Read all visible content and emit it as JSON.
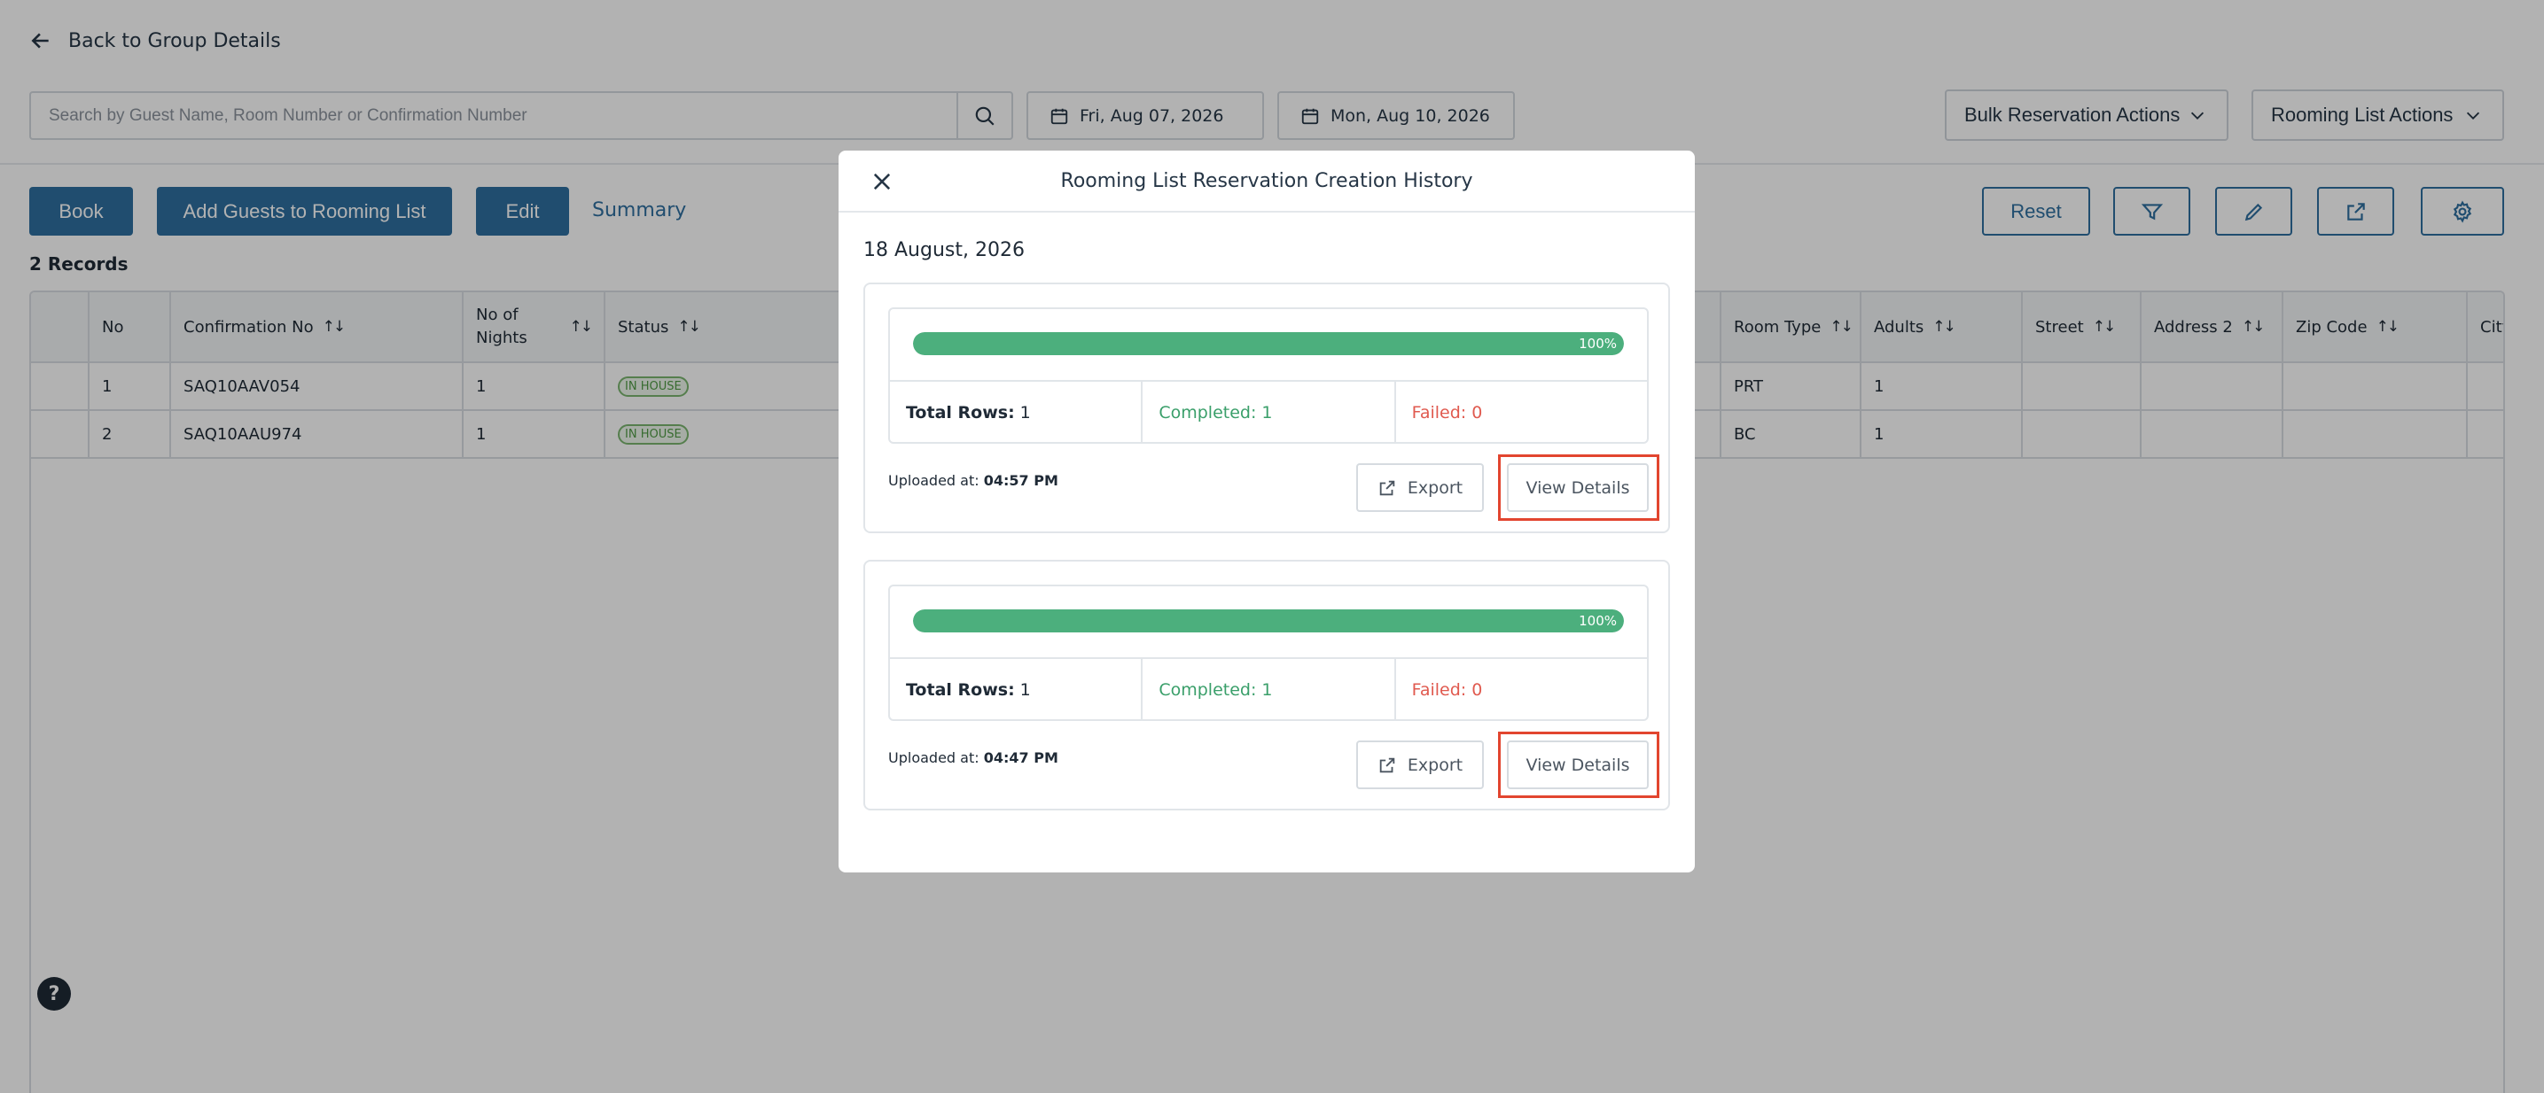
{
  "page": {
    "back_label": "Back to Group Details",
    "search_placeholder": "Search by Guest Name, Room Number or Confirmation Number",
    "date_from": "Fri, Aug 07, 2026",
    "date_to": "Mon, Aug 10, 2026",
    "bulk_actions": "Bulk Reservation Actions",
    "rooming_actions": "Rooming List Actions",
    "buttons": {
      "book": "Book",
      "add_guests": "Add Guests to Rooming List",
      "edit": "Edit",
      "summary": "Summary",
      "reset": "Reset"
    },
    "records": "2 Records",
    "table": {
      "columns": [
        "No",
        "Confirmation No",
        "No of Nights",
        "Status",
        "Room Type",
        "Adults",
        "Street",
        "Address 2",
        "Zip Code",
        "City"
      ],
      "rows": [
        {
          "no": "1",
          "confirmation": "SAQ10AAV054",
          "nights": "1",
          "status": "IN HOUSE",
          "room_type": "PRT",
          "adults": "1"
        },
        {
          "no": "2",
          "confirmation": "SAQ10AAU974",
          "nights": "1",
          "status": "IN HOUSE",
          "room_type": "BC",
          "adults": "1"
        }
      ]
    },
    "help": "?"
  },
  "modal": {
    "title": "Rooming List Reservation Creation History",
    "date": "18 August, 2026",
    "entries": [
      {
        "progress_label": "100%",
        "progress": 1.0,
        "total_label": "Total Rows:",
        "total_value": "1",
        "completed": "Completed: 1",
        "failed": "Failed: 0",
        "uploaded_label": "Uploaded at:",
        "uploaded_time": "04:57 PM",
        "export_label": "Export",
        "details_label": "View Details"
      },
      {
        "progress_label": "100%",
        "progress": 1.0,
        "total_label": "Total Rows:",
        "total_value": "1",
        "completed": "Completed: 1",
        "failed": "Failed: 0",
        "uploaded_label": "Uploaded at:",
        "uploaded_time": "04:47 PM",
        "export_label": "Export",
        "details_label": "View Details"
      }
    ]
  },
  "colors": {
    "primary": "#2f6f9f",
    "progress": "#4caf7d",
    "success": "#3a9f6a",
    "danger": "#e05a4f",
    "highlight": "#e2452f"
  },
  "icons": [
    "arrow-left-icon",
    "search-icon",
    "calendar-icon",
    "chevron-down-icon",
    "filter-icon",
    "pencil-icon",
    "external-link-icon",
    "gear-icon",
    "close-icon",
    "help-icon"
  ]
}
